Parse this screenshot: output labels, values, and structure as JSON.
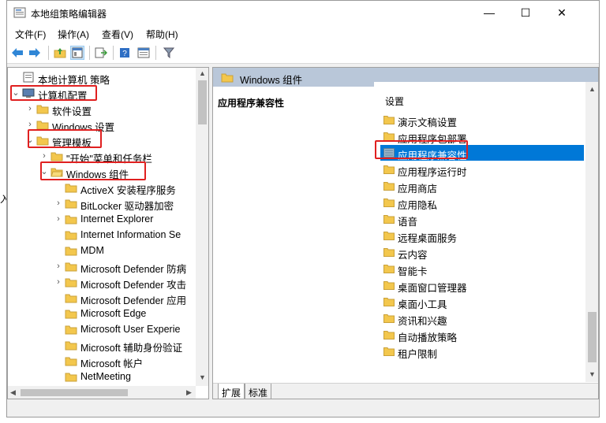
{
  "window": {
    "title": "本地组策略编辑器",
    "min": "—",
    "max": "☐",
    "close": "✕"
  },
  "menu": [
    "文件(F)",
    "操作(A)",
    "查看(V)",
    "帮助(H)"
  ],
  "tree": [
    {
      "label": "本地计算机 策略",
      "indent": 0,
      "arrow": "",
      "icon": "policy",
      "highlight": false
    },
    {
      "label": "计算机配置",
      "indent": 0,
      "arrow": "v",
      "icon": "computer",
      "highlight": true
    },
    {
      "label": "软件设置",
      "indent": 1,
      "arrow": ">",
      "icon": "folder",
      "highlight": false
    },
    {
      "label": "Windows 设置",
      "indent": 1,
      "arrow": ">",
      "icon": "folder",
      "highlight": false
    },
    {
      "label": "管理模板",
      "indent": 1,
      "arrow": "v",
      "icon": "folder",
      "highlight": true
    },
    {
      "label": "\"开始\"菜单和任务栏",
      "indent": 2,
      "arrow": ">",
      "icon": "folder",
      "highlight": false
    },
    {
      "label": "Windows 组件",
      "indent": 2,
      "arrow": "v",
      "icon": "folder-open",
      "highlight": true
    },
    {
      "label": "ActiveX 安装程序服务",
      "indent": 3,
      "arrow": "",
      "icon": "folder",
      "highlight": false
    },
    {
      "label": "BitLocker 驱动器加密",
      "indent": 3,
      "arrow": ">",
      "icon": "folder",
      "highlight": false
    },
    {
      "label": "Internet Explorer",
      "indent": 3,
      "arrow": ">",
      "icon": "folder",
      "highlight": false
    },
    {
      "label": "Internet Information Se",
      "indent": 3,
      "arrow": "",
      "icon": "folder",
      "highlight": false
    },
    {
      "label": "MDM",
      "indent": 3,
      "arrow": "",
      "icon": "folder",
      "highlight": false
    },
    {
      "label": "Microsoft Defender 防病",
      "indent": 3,
      "arrow": ">",
      "icon": "folder",
      "highlight": false
    },
    {
      "label": "Microsoft Defender 攻击",
      "indent": 3,
      "arrow": ">",
      "icon": "folder",
      "highlight": false
    },
    {
      "label": "Microsoft Defender 应用",
      "indent": 3,
      "arrow": "",
      "icon": "folder",
      "highlight": false
    },
    {
      "label": "Microsoft Edge",
      "indent": 3,
      "arrow": "",
      "icon": "folder",
      "highlight": false
    },
    {
      "label": "Microsoft User Experie",
      "indent": 3,
      "arrow": "",
      "icon": "folder",
      "highlight": false
    },
    {
      "label": "Microsoft 辅助身份验证",
      "indent": 3,
      "arrow": "",
      "icon": "folder",
      "highlight": false
    },
    {
      "label": "Microsoft 帐户",
      "indent": 3,
      "arrow": "",
      "icon": "folder",
      "highlight": false
    },
    {
      "label": "NetMeeting",
      "indent": 3,
      "arrow": "",
      "icon": "folder",
      "highlight": false
    }
  ],
  "right": {
    "header": "Windows 组件",
    "desc_title": "应用程序兼容性",
    "list_header": "设置",
    "items": [
      {
        "label": "演示文稿设置",
        "selected": false,
        "highlight": false
      },
      {
        "label": "应用程序包部署",
        "selected": false,
        "highlight": false
      },
      {
        "label": "应用程序兼容性",
        "selected": true,
        "highlight": true
      },
      {
        "label": "应用程序运行时",
        "selected": false,
        "highlight": false
      },
      {
        "label": "应用商店",
        "selected": false,
        "highlight": false
      },
      {
        "label": "应用隐私",
        "selected": false,
        "highlight": false
      },
      {
        "label": "语音",
        "selected": false,
        "highlight": false
      },
      {
        "label": "远程桌面服务",
        "selected": false,
        "highlight": false
      },
      {
        "label": "云内容",
        "selected": false,
        "highlight": false
      },
      {
        "label": "智能卡",
        "selected": false,
        "highlight": false
      },
      {
        "label": "桌面窗口管理器",
        "selected": false,
        "highlight": false
      },
      {
        "label": "桌面小工具",
        "selected": false,
        "highlight": false
      },
      {
        "label": "资讯和兴趣",
        "selected": false,
        "highlight": false
      },
      {
        "label": "自动播放策略",
        "selected": false,
        "highlight": false
      },
      {
        "label": "租户限制",
        "selected": false,
        "highlight": false
      }
    ],
    "tabs": [
      "扩展",
      "标准"
    ]
  },
  "edge_char": "入",
  "colors": {
    "accent": "#0078d7",
    "highlight": "#e02020",
    "folder": "#f3c74d",
    "header": "#b9c7d9"
  }
}
